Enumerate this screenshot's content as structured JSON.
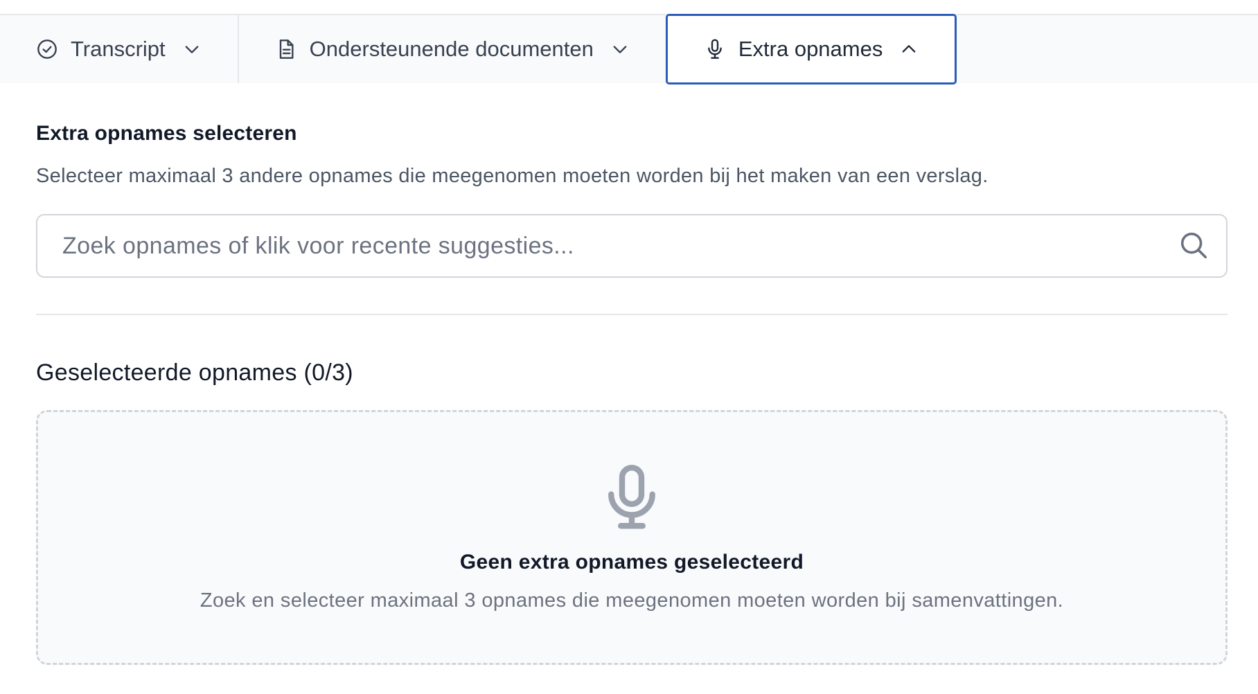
{
  "tabs": [
    {
      "label": "Transcript",
      "icon": "check-circle-icon",
      "expanded": false
    },
    {
      "label": "Ondersteunende documenten",
      "icon": "document-icon",
      "expanded": false
    },
    {
      "label": "Extra opnames",
      "icon": "microphone-icon",
      "expanded": true
    }
  ],
  "section": {
    "title": "Extra opnames selecteren",
    "description": "Selecteer maximaal 3 andere opnames die meegenomen moeten worden bij het maken van een verslag."
  },
  "search": {
    "placeholder": "Zoek opnames of klik voor recente suggesties...",
    "value": ""
  },
  "selected": {
    "title": "Geselecteerde opnames (0/3)",
    "count": 0,
    "max": 3
  },
  "empty_state": {
    "icon": "microphone-icon",
    "title": "Geen extra opnames geselecteerd",
    "description": "Zoek en selecteer maximaal 3 opnames die meegenomen moeten worden bij samenvattingen."
  },
  "colors": {
    "accent": "#2b5cb8",
    "border": "#d1d5db",
    "muted_text": "#6b7280"
  }
}
